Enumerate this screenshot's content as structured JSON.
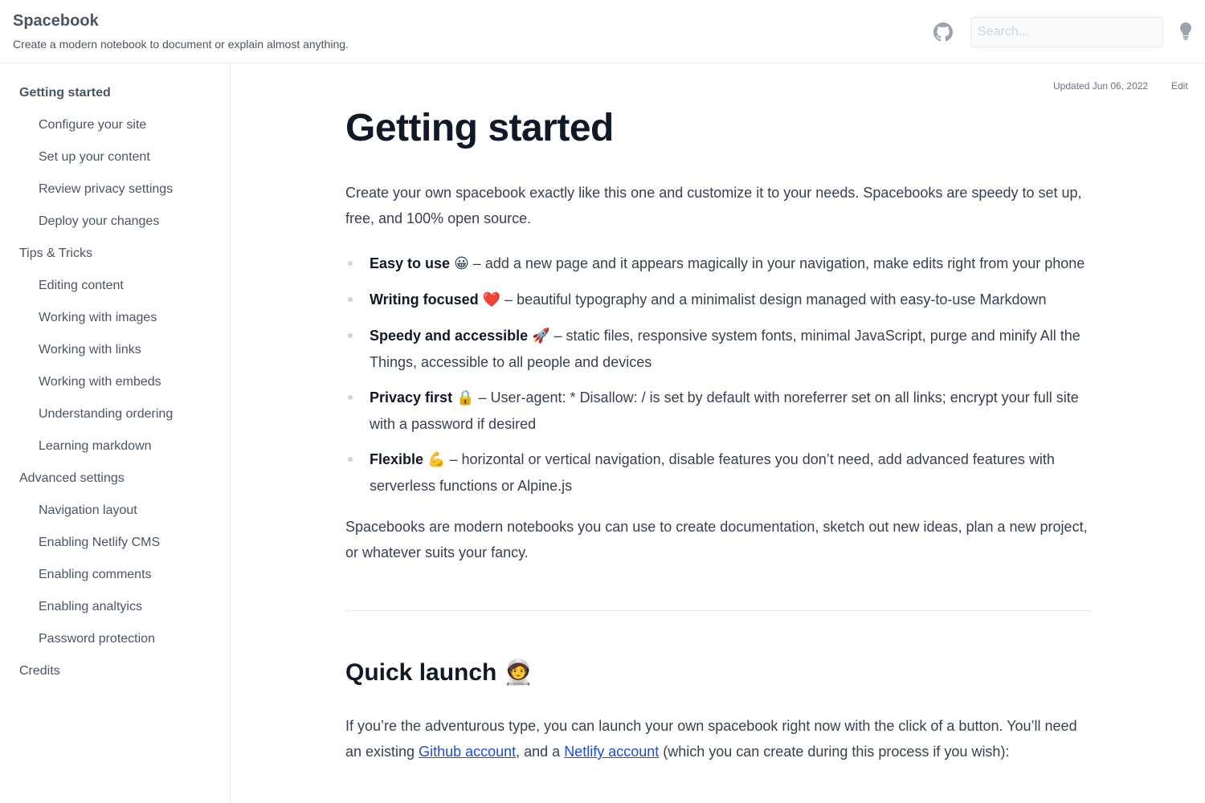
{
  "header": {
    "title": "Spacebook",
    "description": "Create a modern notebook to document or explain almost anything.",
    "search_placeholder": "Search...",
    "github_icon": "github-icon",
    "theme_icon": "lightbulb-icon"
  },
  "sidebar": {
    "items": [
      {
        "label": "Getting started",
        "level": 0,
        "active": true
      },
      {
        "label": "Configure your site",
        "level": 1
      },
      {
        "label": "Set up your content",
        "level": 1
      },
      {
        "label": "Review privacy settings",
        "level": 1
      },
      {
        "label": "Deploy your changes",
        "level": 1
      },
      {
        "label": "Tips & Tricks",
        "level": 0
      },
      {
        "label": "Editing content",
        "level": 1
      },
      {
        "label": "Working with images",
        "level": 1
      },
      {
        "label": "Working with links",
        "level": 1
      },
      {
        "label": "Working with embeds",
        "level": 1
      },
      {
        "label": "Understanding ordering",
        "level": 1
      },
      {
        "label": "Learning markdown",
        "level": 1
      },
      {
        "label": "Advanced settings",
        "level": 0
      },
      {
        "label": "Navigation layout",
        "level": 1
      },
      {
        "label": "Enabling Netlify CMS",
        "level": 1
      },
      {
        "label": "Enabling comments",
        "level": 1
      },
      {
        "label": "Enabling analtyics",
        "level": 1
      },
      {
        "label": "Password protection",
        "level": 1
      },
      {
        "label": "Credits",
        "level": 0
      }
    ]
  },
  "meta": {
    "updated": "Updated Jun 06, 2022",
    "edit": "Edit"
  },
  "main": {
    "title": "Getting started",
    "intro": "Create your own spacebook exactly like this one and customize it to your needs. Spacebooks are speedy to set up, free, and 100% open source.",
    "features": [
      {
        "name": "Easy to use",
        "emoji": "😀",
        "text": " – add a new page and it appears magically in your navigation, make edits right from your phone"
      },
      {
        "name": "Writing focused",
        "emoji": "❤️",
        "text": " – beautiful typography and a minimalist design managed with easy-to-use Markdown"
      },
      {
        "name": "Speedy and accessible",
        "emoji": "🚀",
        "text": " – static files, responsive system fonts, minimal JavaScript, purge and minify All the Things, accessible to all people and devices"
      },
      {
        "name": "Privacy first",
        "emoji": "🔒",
        "text": " – User-agent: * Disallow: / is set by default with noreferrer set on all links; encrypt your full site with a password if desired"
      },
      {
        "name": "Flexible",
        "emoji": "💪",
        "text": " – horizontal or vertical navigation, disable features you don’t need, add advanced features with serverless functions or Alpine.js"
      }
    ],
    "closing": "Spacebooks are modern notebooks you can use to create documentation, sketch out new ideas, plan a new project, or whatever suits your fancy.",
    "quick_launch": {
      "heading": "Quick launch",
      "heading_emoji": "🧑‍🚀",
      "text_before": "If you’re the adventurous type, you can launch your own spacebook right now with the click of a button. You’ll need an existing ",
      "link1": "Github account",
      "text_middle": ", and a ",
      "link2": "Netlify account",
      "text_after": " (which you can create during this process if you wish):"
    }
  }
}
